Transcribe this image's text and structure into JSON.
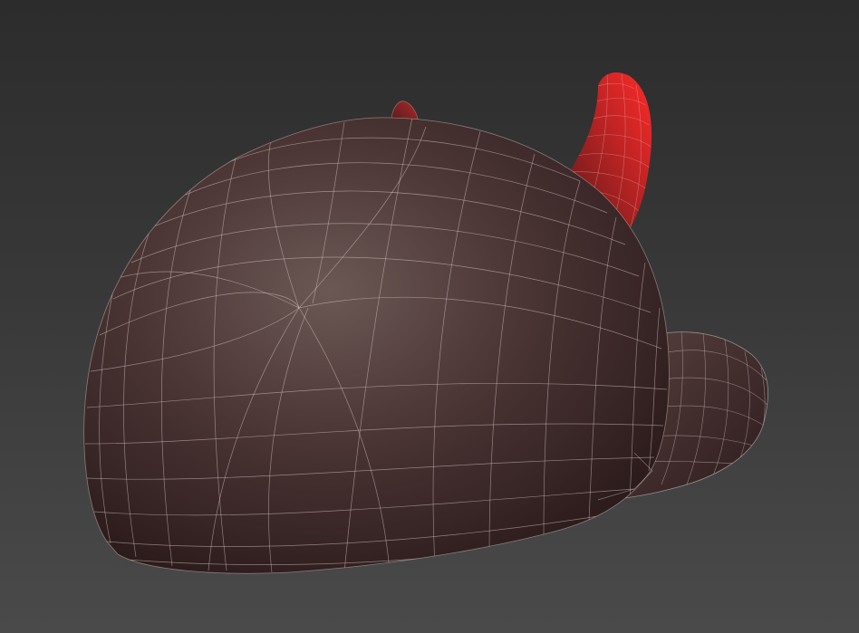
{
  "viewport": {
    "object": "devil-horned-cap",
    "shading": "wireframe-on-shaded",
    "colors": {
      "background_top": "#2c2c2c",
      "background_bottom": "#4a4a4a",
      "cap_body": "#4a3535",
      "cap_highlight": "#6a5552",
      "cap_shadow": "#2a1818",
      "horn_base": "#7a1c1c",
      "horn_tip": "#e02020",
      "wire": "#d8c8c8"
    }
  }
}
